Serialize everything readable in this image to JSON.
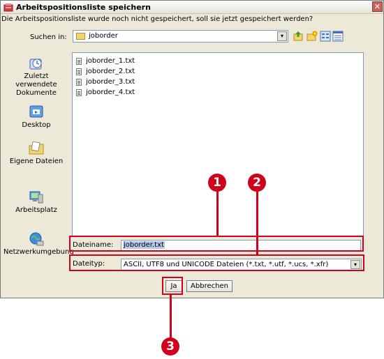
{
  "window": {
    "title": "Arbeitspositionsliste speichern",
    "close_symbol": "✕"
  },
  "message": "Die Arbeitspositionsliste wurde noch nicht gespeichert, soll sie jetzt gespeichert werden?",
  "lookin": {
    "label": "Suchen in:",
    "value": "joborder",
    "arrow": "▾"
  },
  "toolbar": {
    "icons": [
      "up-folder-icon",
      "new-folder-icon",
      "list-view-icon",
      "details-view-icon"
    ]
  },
  "places": [
    {
      "label": "Zuletzt verwendete Dokumente",
      "icon": "recent-documents-icon"
    },
    {
      "label": "Desktop",
      "icon": "desktop-icon"
    },
    {
      "label": "Eigene Dateien",
      "icon": "my-documents-icon"
    },
    {
      "label": "Arbeitsplatz",
      "icon": "my-computer-icon"
    },
    {
      "label": "Netzwerkumgebung",
      "icon": "network-icon"
    }
  ],
  "files": [
    "joborder_1.txt",
    "joborder_2.txt",
    "joborder_3.txt",
    "joborder_4.txt"
  ],
  "filename": {
    "label": "Dateiname:",
    "value": "joborder.txt"
  },
  "filetype": {
    "label": "Dateityp:",
    "value": "ASCII, UTF8 und UNICODE Dateien (*.txt, *.utf, *.ucs, *.xfr)",
    "arrow": "▾"
  },
  "buttons": {
    "yes": "Ja",
    "cancel": "Abbrechen"
  },
  "callouts": [
    "1",
    "2",
    "3"
  ],
  "colors": {
    "callout": "#d0021b",
    "accent_border": "#7f9db9"
  }
}
